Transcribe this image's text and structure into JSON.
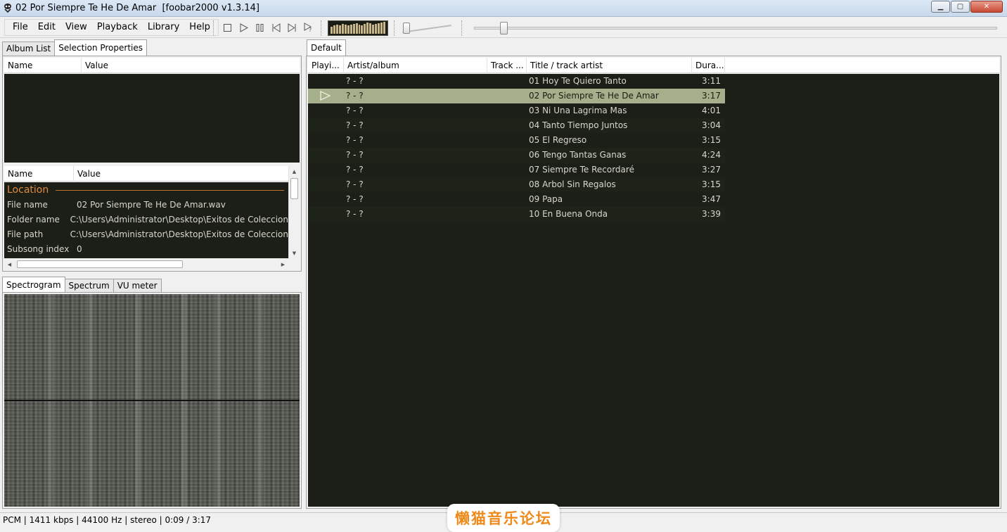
{
  "window": {
    "title": "02 Por Siempre Te He De Amar  [foobar2000 v1.3.14]",
    "controls": [
      "minimize",
      "maximize",
      "close"
    ]
  },
  "menu": {
    "items": [
      "File",
      "Edit",
      "View",
      "Playback",
      "Library",
      "Help"
    ]
  },
  "toolbar": {
    "buttons": [
      "stop-icon",
      "play-icon",
      "pause-icon",
      "previous-icon",
      "next-icon",
      "random-icon"
    ],
    "volume_fraction": 0.05,
    "seek_fraction": 0.05
  },
  "left_tabs": [
    "Album List",
    "Selection Properties"
  ],
  "top_props": {
    "headers": [
      "Name",
      "Value"
    ]
  },
  "props": {
    "headers": [
      "Name",
      "Value"
    ],
    "section": "Location",
    "rows": [
      {
        "key": "File name",
        "value": "02 Por Siempre Te He De Amar.wav"
      },
      {
        "key": "Folder name",
        "value": "C:\\Users\\Administrator\\Desktop\\Exitos de Coleccion"
      },
      {
        "key": "File path",
        "value": "C:\\Users\\Administrator\\Desktop\\Exitos de Coleccion"
      },
      {
        "key": "Subsong index",
        "value": "0"
      }
    ]
  },
  "viz_tabs": [
    "Spectrogram",
    "Spectrum",
    "VU meter"
  ],
  "playlist": {
    "tab": "Default",
    "headers": [
      "Playi...",
      "Artist/album",
      "Track ...",
      "Title / track artist",
      "Dura..."
    ],
    "rows": [
      {
        "artist": "? - ?",
        "title": "01 Hoy Te Quiero Tanto",
        "duration": "3:11",
        "playing": false
      },
      {
        "artist": "? - ?",
        "title": "02 Por Siempre Te He De Amar",
        "duration": "3:17",
        "playing": true
      },
      {
        "artist": "? - ?",
        "title": "03 Ni Una Lagrima Mas",
        "duration": "4:01",
        "playing": false
      },
      {
        "artist": "? - ?",
        "title": "04 Tanto Tiempo Juntos",
        "duration": "3:04",
        "playing": false
      },
      {
        "artist": "? - ?",
        "title": "05 El Regreso",
        "duration": "3:15",
        "playing": false
      },
      {
        "artist": "? - ?",
        "title": "06 Tengo Tantas Ganas",
        "duration": "4:24",
        "playing": false
      },
      {
        "artist": "? - ?",
        "title": "07 Siempre Te Recordaré",
        "duration": "3:27",
        "playing": false
      },
      {
        "artist": "? - ?",
        "title": "08 Arbol Sin Regalos",
        "duration": "3:15",
        "playing": false
      },
      {
        "artist": "? - ?",
        "title": "09 Papa",
        "duration": "3:47",
        "playing": false
      },
      {
        "artist": "? - ?",
        "title": "10 En Buena Onda",
        "duration": "3:39",
        "playing": false
      }
    ]
  },
  "status": {
    "text": "PCM | 1411 kbps | 44100 Hz | stereo | 0:09 / 3:17"
  },
  "watermark": "懒猫音乐论坛",
  "colors": {
    "list_bg": "#1b1f17",
    "selected_row": "#a5af8c",
    "accent": "#e08a3c",
    "watermark": "#ee8a1a"
  }
}
